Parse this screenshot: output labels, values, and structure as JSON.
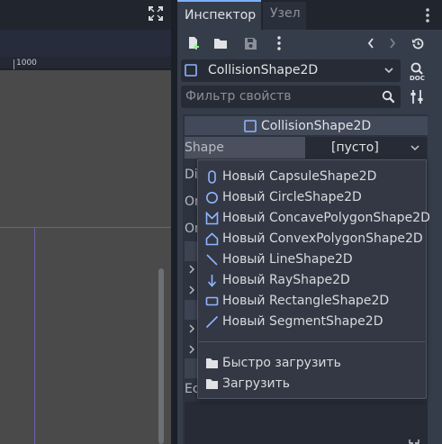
{
  "ruler": {
    "label": "1000"
  },
  "tabs": [
    {
      "label": "Инспектор",
      "active": true
    },
    {
      "label": "Узел",
      "active": false
    }
  ],
  "inspector": {
    "object_name": "CollisionShape2D",
    "filter_placeholder": "Фильтр свойств",
    "section_title": "CollisionShape2D",
    "shape_label": "Shape",
    "shape_value": "[пусто]",
    "row_labels": [
      "Di",
      "On",
      "On",
      "Ec"
    ]
  },
  "popup": {
    "items": [
      {
        "label": "Новый CapsuleShape2D",
        "icon": "capsule-icon"
      },
      {
        "label": "Новый CircleShape2D",
        "icon": "circle-icon"
      },
      {
        "label": "Новый ConcavePolygonShape2D",
        "icon": "concave-polygon-icon"
      },
      {
        "label": "Новый ConvexPolygonShape2D",
        "icon": "convex-polygon-icon"
      },
      {
        "label": "Новый LineShape2D",
        "icon": "line-icon"
      },
      {
        "label": "Новый RayShape2D",
        "icon": "ray-icon"
      },
      {
        "label": "Новый RectangleShape2D",
        "icon": "rectangle-icon"
      },
      {
        "label": "Новый SegmentShape2D",
        "icon": "segment-icon"
      }
    ],
    "actions": [
      {
        "label": "Быстро загрузить",
        "icon": "folder-icon"
      },
      {
        "label": "Загрузить",
        "icon": "folder-icon"
      }
    ]
  },
  "colors": {
    "accent": "#7bb0ff",
    "axis_x": "#b24a52",
    "axis_y": "#6b63a6",
    "viewport": "#4a4a4a",
    "panel": "#363d4a"
  }
}
